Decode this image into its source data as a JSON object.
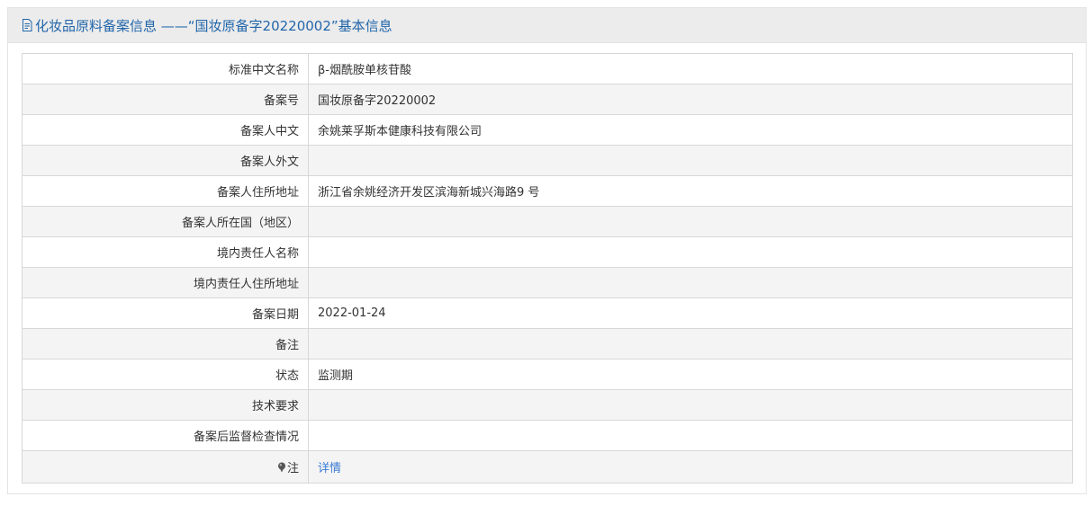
{
  "header": {
    "icon": "document-icon",
    "title": "化妆品原料备案信息 ——“国妆原备字20220002”基本信息"
  },
  "rows": [
    {
      "label": "标准中文名称",
      "value": "β-烟酰胺单核苷酸"
    },
    {
      "label": "备案号",
      "value": "国妆原备字20220002"
    },
    {
      "label": "备案人中文",
      "value": "余姚莱孚斯本健康科技有限公司"
    },
    {
      "label": "备案人外文",
      "value": ""
    },
    {
      "label": "备案人住所地址",
      "value": "浙江省余姚经济开发区滨海新城兴海路9 号"
    },
    {
      "label": "备案人所在国（地区）",
      "value": ""
    },
    {
      "label": "境内责任人名称",
      "value": ""
    },
    {
      "label": "境内责任人住所地址",
      "value": ""
    },
    {
      "label": "备案日期",
      "value": "2022-01-24"
    },
    {
      "label": "备注",
      "value": ""
    },
    {
      "label": "状态",
      "value": "监测期"
    },
    {
      "label": "技术要求",
      "value": ""
    },
    {
      "label": "备案后监督检查情况",
      "value": ""
    }
  ],
  "note_row": {
    "icon": "pin-icon",
    "label": "注",
    "link_text": "详情"
  },
  "colors": {
    "title": "#2266aa",
    "link": "#3a7bd5",
    "header_bg": "#ececec",
    "stripe_bg": "#f4f4f4",
    "border": "#d8d8d8"
  }
}
